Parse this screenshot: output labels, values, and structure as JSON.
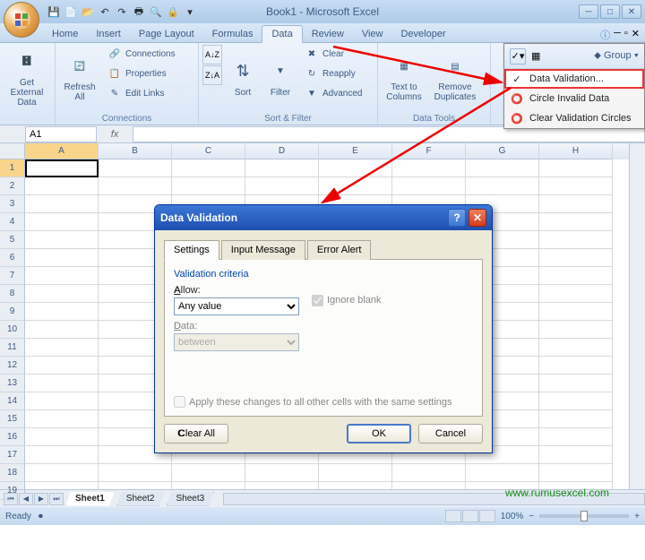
{
  "window": {
    "title": "Book1 - Microsoft Excel"
  },
  "tabs": [
    "Home",
    "Insert",
    "Page Layout",
    "Formulas",
    "Data",
    "Review",
    "View",
    "Developer"
  ],
  "active_tab": "Data",
  "ribbon": {
    "get_external": {
      "label": "Get External\nData",
      "group": ""
    },
    "connections": {
      "refresh": "Refresh\nAll",
      "conn": "Connections",
      "prop": "Properties",
      "links": "Edit Links",
      "group": "Connections"
    },
    "sort_filter": {
      "sort": "Sort",
      "filter": "Filter",
      "clear": "Clear",
      "reapply": "Reapply",
      "advanced": "Advanced",
      "group": "Sort & Filter"
    },
    "data_tools": {
      "ttc": "Text to\nColumns",
      "rdup": "Remove\nDuplicates",
      "group": "Data Tools"
    },
    "outline": {
      "grp": "Group"
    }
  },
  "dv_menu": {
    "items": [
      "Data Validation...",
      "Circle Invalid Data",
      "Clear Validation Circles"
    ]
  },
  "name_box": "A1",
  "columns": [
    "A",
    "B",
    "C",
    "D",
    "E",
    "F",
    "G",
    "H"
  ],
  "rows": 19,
  "sheets": [
    "Sheet1",
    "Sheet2",
    "Sheet3"
  ],
  "status": {
    "ready": "Ready",
    "zoom": "100%"
  },
  "dialog": {
    "title": "Data Validation",
    "tabs": [
      "Settings",
      "Input Message",
      "Error Alert"
    ],
    "criteria": "Validation criteria",
    "allow": "Allow:",
    "allow_val": "Any value",
    "data": "Data:",
    "data_val": "between",
    "ignore": "Ignore blank",
    "apply": "Apply these changes to all other cells with the same settings",
    "clear": "Clear All",
    "ok": "OK",
    "cancel": "Cancel"
  },
  "watermark": "www.rumusexcel.com"
}
